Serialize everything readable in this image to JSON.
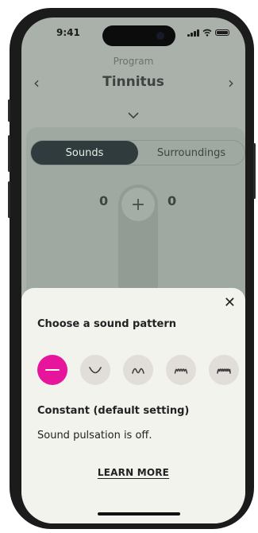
{
  "status_bar": {
    "time": "9:41"
  },
  "header": {
    "program_label": "Program",
    "program_name": "Tinnitus"
  },
  "tabs": [
    {
      "label": "Sounds",
      "active": true
    },
    {
      "label": "Surroundings",
      "active": false
    }
  ],
  "volume": {
    "left": "0",
    "right": "0",
    "plus_label": "+"
  },
  "sound_pattern_sheet": {
    "title": "Choose a sound pattern",
    "patterns": [
      {
        "icon": "constant-pattern-icon",
        "selected": true
      },
      {
        "icon": "single-wave-pattern-icon",
        "selected": false
      },
      {
        "icon": "double-wave-pattern-icon",
        "selected": false
      },
      {
        "icon": "triple-wave-pattern-icon",
        "selected": false
      },
      {
        "icon": "quad-wave-pattern-icon",
        "selected": false
      }
    ],
    "selected_name": "Constant (default setting)",
    "selected_description": "Sound pulsation is off.",
    "learn_more": "LEARN MORE"
  },
  "colors": {
    "accent": "#e6159b",
    "overlay": "#aab1ab",
    "sheet_bg": "#f3f3ee",
    "active_tab": "#2f3b3c"
  }
}
